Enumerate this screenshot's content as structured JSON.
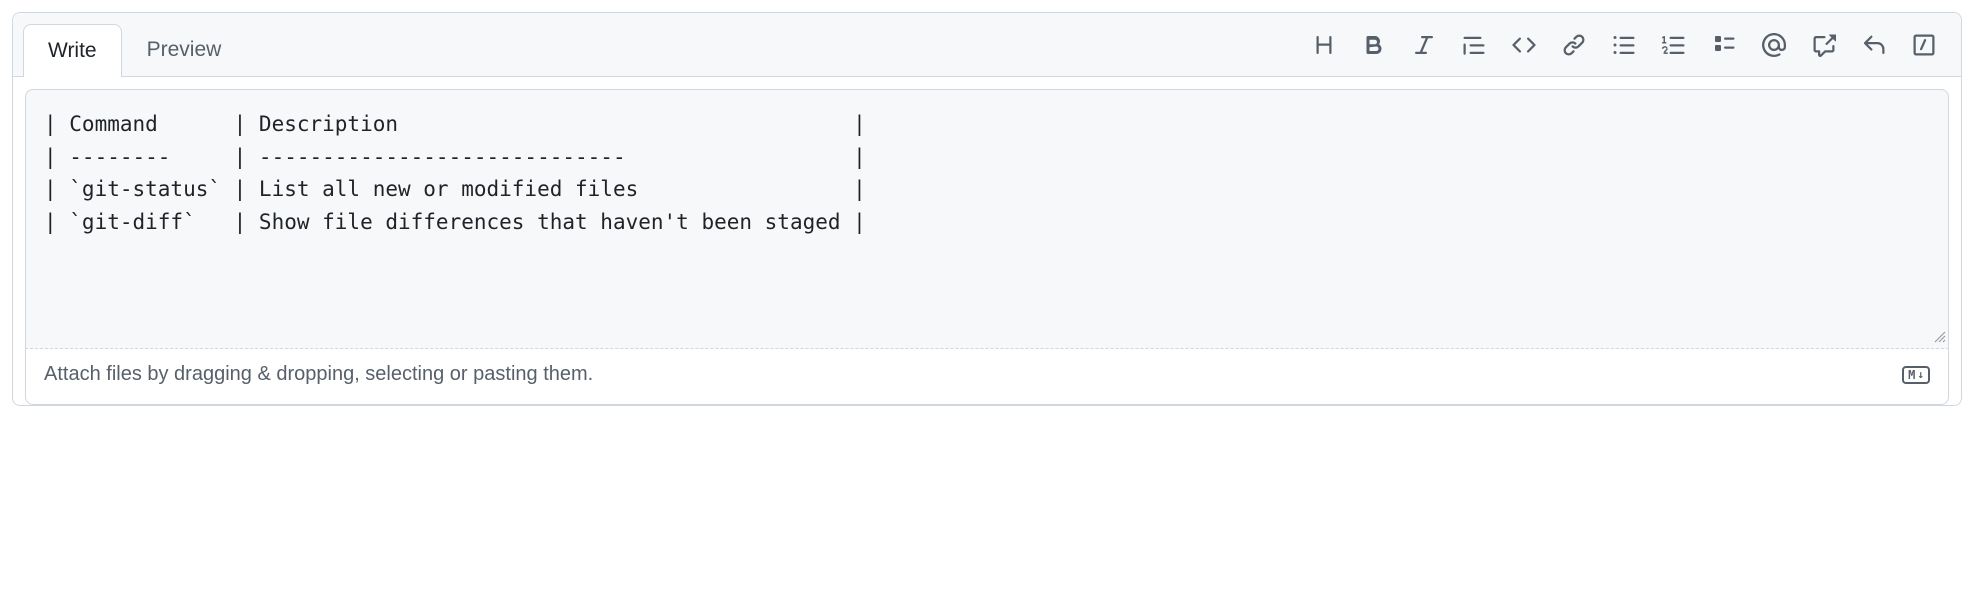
{
  "tabs": {
    "write": "Write",
    "preview": "Preview"
  },
  "editor": {
    "content": "| Command      | Description                                    |\n| --------     | -----------------------------                  |\n| `git-status` | List all new or modified files                 |\n| `git-diff`   | Show file differences that haven't been staged |"
  },
  "footer": {
    "hint": "Attach files by dragging & dropping, selecting or pasting them.",
    "markdown_label": "M"
  },
  "toolbar": {
    "heading": "heading-icon",
    "bold": "bold-icon",
    "italic": "italic-icon",
    "quote": "quote-icon",
    "code": "code-icon",
    "link": "link-icon",
    "ul": "unordered-list-icon",
    "ol": "ordered-list-icon",
    "task": "task-list-icon",
    "mention": "mention-icon",
    "reference": "cross-reference-icon",
    "reply": "reply-icon",
    "slash": "slash-commands-icon"
  }
}
